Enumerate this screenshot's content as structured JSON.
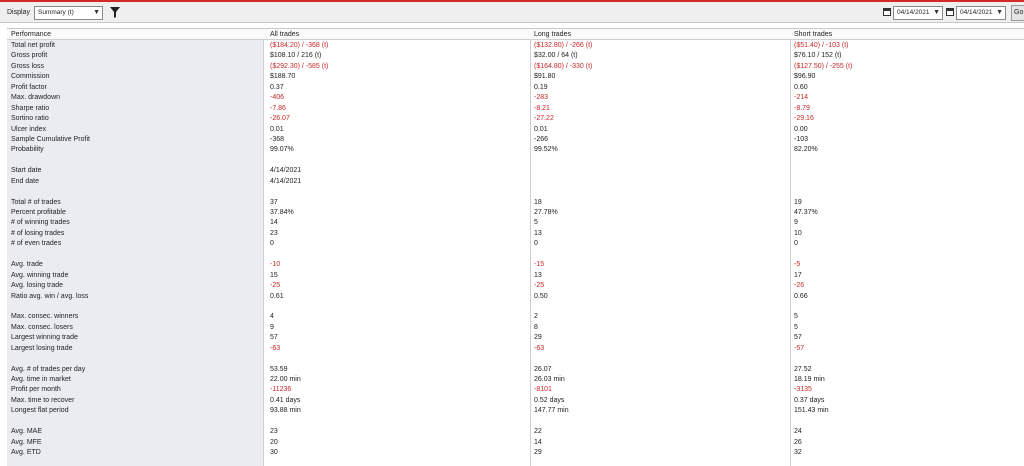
{
  "toolbar": {
    "display_label": "Display",
    "display_value": "Summary (t)",
    "date_from": "04/14/2021",
    "date_to": "04/14/2021",
    "go_label": "Go"
  },
  "table": {
    "headers": [
      "Performance",
      "All trades",
      "Long trades",
      "Short trades"
    ],
    "rows": [
      {
        "label": "Total net profit",
        "all": "($184.20) / -368 (t)",
        "long": "($132.80) / -266 (t)",
        "short": "($51.40) / -103 (t)",
        "neg": true
      },
      {
        "label": "Gross profit",
        "all": "$108.10 / 216 (t)",
        "long": "$32.00 / 64 (t)",
        "short": "$76.10 / 152 (t)",
        "neg": false
      },
      {
        "label": "Gross loss",
        "all": "($292.30) / -585 (t)",
        "long": "($164.80) / -330 (t)",
        "short": "($127.50) / -255 (t)",
        "neg": true
      },
      {
        "label": "Commission",
        "all": "$188.70",
        "long": "$91.80",
        "short": "$96.90",
        "neg": false
      },
      {
        "label": "Profit factor",
        "all": "0.37",
        "long": "0.19",
        "short": "0.60",
        "neg": false
      },
      {
        "label": "Max. drawdown",
        "all": "-406",
        "long": "-283",
        "short": "-214",
        "neg": true
      },
      {
        "label": "Sharpe ratio",
        "all": "-7.86",
        "long": "-8.21",
        "short": "-8.79",
        "neg": true
      },
      {
        "label": "Sortino ratio",
        "all": "-26.07",
        "long": "-27.22",
        "short": "-29.16",
        "neg": true
      },
      {
        "label": "Ulcer index",
        "all": "0.01",
        "long": "0.01",
        "short": "0.00",
        "neg": false
      },
      {
        "label": "Sample Cumulative Profit",
        "all": "-368",
        "long": "-266",
        "short": "-103",
        "neg": false
      },
      {
        "label": "Probability",
        "all": "99.07%",
        "long": "99.52%",
        "short": "82.20%",
        "neg": false
      },
      {
        "label": "",
        "all": "",
        "long": "",
        "short": "",
        "neg": false
      },
      {
        "label": "Start date",
        "all": "4/14/2021",
        "long": "",
        "short": "",
        "neg": false
      },
      {
        "label": "End date",
        "all": "4/14/2021",
        "long": "",
        "short": "",
        "neg": false
      },
      {
        "label": "",
        "all": "",
        "long": "",
        "short": "",
        "neg": false
      },
      {
        "label": "Total # of trades",
        "all": "37",
        "long": "18",
        "short": "19",
        "neg": false
      },
      {
        "label": "Percent profitable",
        "all": "37.84%",
        "long": "27.78%",
        "short": "47.37%",
        "neg": false
      },
      {
        "label": "# of winning trades",
        "all": "14",
        "long": "5",
        "short": "9",
        "neg": false
      },
      {
        "label": "# of losing trades",
        "all": "23",
        "long": "13",
        "short": "10",
        "neg": false
      },
      {
        "label": "# of even trades",
        "all": "0",
        "long": "0",
        "short": "0",
        "neg": false
      },
      {
        "label": "",
        "all": "",
        "long": "",
        "short": "",
        "neg": false
      },
      {
        "label": "Avg. trade",
        "all": "-10",
        "long": "-15",
        "short": "-5",
        "neg": true
      },
      {
        "label": "Avg. winning trade",
        "all": "15",
        "long": "13",
        "short": "17",
        "neg": false
      },
      {
        "label": "Avg. losing trade",
        "all": "-25",
        "long": "-25",
        "short": "-26",
        "neg": true
      },
      {
        "label": "Ratio avg. win / avg. loss",
        "all": "0.61",
        "long": "0.50",
        "short": "0.66",
        "neg": false
      },
      {
        "label": "",
        "all": "",
        "long": "",
        "short": "",
        "neg": false
      },
      {
        "label": "Max. consec. winners",
        "all": "4",
        "long": "2",
        "short": "5",
        "neg": false
      },
      {
        "label": "Max. consec. losers",
        "all": "9",
        "long": "8",
        "short": "5",
        "neg": false
      },
      {
        "label": "Largest winning trade",
        "all": "57",
        "long": "29",
        "short": "57",
        "neg": false
      },
      {
        "label": "Largest losing trade",
        "all": "-63",
        "long": "-63",
        "short": "-57",
        "neg": true
      },
      {
        "label": "",
        "all": "",
        "long": "",
        "short": "",
        "neg": false
      },
      {
        "label": "Avg. # of trades per day",
        "all": "53.59",
        "long": "26.07",
        "short": "27.52",
        "neg": false
      },
      {
        "label": "Avg. time in market",
        "all": "22.00 min",
        "long": "26.03 min",
        "short": "18.19 min",
        "neg": false
      },
      {
        "label": "Profit per month",
        "all": "-11236",
        "long": "-8101",
        "short": "-3135",
        "neg": true
      },
      {
        "label": "Max. time to recover",
        "all": "0.41 days",
        "long": "0.52 days",
        "short": "0.37 days",
        "neg": false
      },
      {
        "label": "Longest flat period",
        "all": "93.88 min",
        "long": "147.77 min",
        "short": "151.43 min",
        "neg": false
      },
      {
        "label": "",
        "all": "",
        "long": "",
        "short": "",
        "neg": false
      },
      {
        "label": "Avg. MAE",
        "all": "23",
        "long": "22",
        "short": "24",
        "neg": false
      },
      {
        "label": "Avg. MFE",
        "all": "20",
        "long": "14",
        "short": "26",
        "neg": false
      },
      {
        "label": "Avg. ETD",
        "all": "30",
        "long": "29",
        "short": "32",
        "neg": false
      }
    ]
  },
  "colors": {
    "negative": "#c62828",
    "top_accent": "#d62828",
    "label_column_bg": "#e9edf1"
  }
}
